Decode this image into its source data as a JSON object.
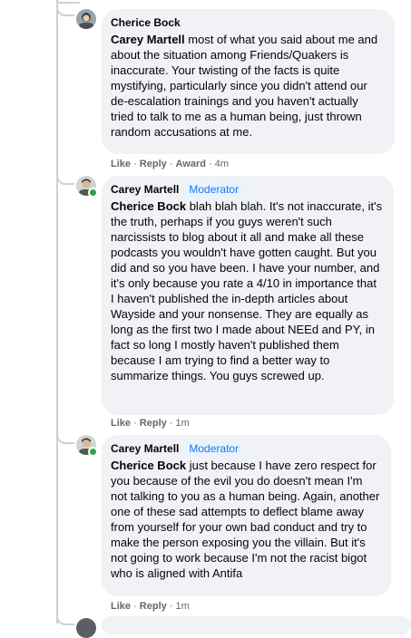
{
  "comments": [
    {
      "author": "Cherice Bock",
      "badge": "",
      "mention": "Carey Martell",
      "text": " most of what you said about me and about the situation among Friends/Quakers is inaccurate. Your twisting of the facts is quite mystifying, particularly since you didn't attend our de-escalation trainings and you haven't actually tried to talk to me as a human being, just thrown random accusations at me.",
      "actions": {
        "like": "Like",
        "reply": "Reply",
        "award": "Award",
        "time": "4m"
      }
    },
    {
      "author": "Carey Martell",
      "badge": "Moderator",
      "mention": "Cherice Bock",
      "text": " blah blah blah. It's not inaccurate, it's the truth, perhaps if you guys weren't such narcissists to blog about it all and make all these podcasts you wouldn't have gotten caught. But you did and so you have been. I have your number, and it's only because you rate a 4/10 in importance that I haven't published the in-depth articles about Wayside and your nonsense. They are equally as long as the first two I made about NEEd and PY, in fact so long I mostly haven't published them because I am trying to find a better way to summarize things. You guys screwed up.",
      "actions": {
        "like": "Like",
        "reply": "Reply",
        "time": "1m"
      }
    },
    {
      "author": "Carey Martell",
      "badge": "Moderator",
      "mention": "Cherice Bock",
      "text": " just because I have zero respect for you because of the evil you do doesn't mean I'm not talking to you as a human being. Again, another one of these sad attempts to deflect blame away from yourself for your own bad conduct and try to make the person exposing you the villain. But it's not going to work because I'm not the racist bigot who is aligned with Antifa",
      "actions": {
        "like": "Like",
        "reply": "Reply",
        "time": "1m"
      }
    }
  ],
  "colors": {
    "bubble": "#f0f2f5",
    "online": "#31a24c",
    "badge_text": "#1877f2",
    "meta": "#65676b"
  }
}
